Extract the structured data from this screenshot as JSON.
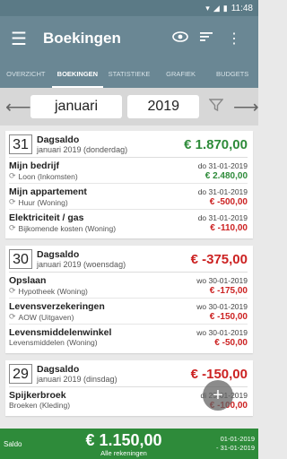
{
  "status": {
    "time": "11:48"
  },
  "appbar": {
    "title": "Boekingen"
  },
  "tabs": [
    {
      "label": "OVERZICHT"
    },
    {
      "label": "BOEKINGEN"
    },
    {
      "label": "STATISTIEKE"
    },
    {
      "label": "GRAFIEK"
    },
    {
      "label": "BUDGETS"
    }
  ],
  "nav": {
    "month": "januari",
    "year": "2019"
  },
  "days": [
    {
      "num": "31",
      "label": "Dagsaldo",
      "date": "januari 2019 (donderdag)",
      "saldo": "€ 1.870,00",
      "tx": [
        {
          "name": "Mijn bedrijf",
          "date": "do 31-01-2019",
          "cat": "Loon (Inkomsten)",
          "amount": "€ 2.480,00"
        },
        {
          "name": "Mijn appartement",
          "date": "do 31-01-2019",
          "cat": "Huur (Woning)",
          "amount": "€ -500,00"
        },
        {
          "name": "Elektriciteit / gas",
          "date": "do 31-01-2019",
          "cat": "Bijkomende kosten (Woning)",
          "amount": "€ -110,00"
        }
      ]
    },
    {
      "num": "30",
      "label": "Dagsaldo",
      "date": "januari 2019 (woensdag)",
      "saldo": "€ -375,00",
      "tx": [
        {
          "name": "Opslaan",
          "date": "wo 30-01-2019",
          "cat": "Hypotheek (Woning)",
          "amount": "€ -175,00"
        },
        {
          "name": "Levensverzekeringen",
          "date": "wo 30-01-2019",
          "cat": "AOW (Uitgaven)",
          "amount": "€ -150,00"
        },
        {
          "name": "Levensmiddelenwinkel",
          "date": "wo 30-01-2019",
          "cat": "Levensmiddelen (Woning)",
          "amount": "€ -50,00"
        }
      ]
    },
    {
      "num": "29",
      "label": "Dagsaldo",
      "date": "januari 2019 (dinsdag)",
      "saldo": "€ -150,00",
      "tx": [
        {
          "name": "Spijkerbroek",
          "date": "di 29-01-2019",
          "cat": "Broeken (Kleding)",
          "amount": "€ -100,00"
        }
      ]
    }
  ],
  "bottom": {
    "label": "Saldo",
    "total": "€ 1.150,00",
    "sub": "Alle rekeningen",
    "from": "01-01-2019",
    "to": "- 31-01-2019"
  },
  "colors": {
    "primary": "#6a8794",
    "green": "#2e8b3a",
    "red": "#cc2222"
  }
}
